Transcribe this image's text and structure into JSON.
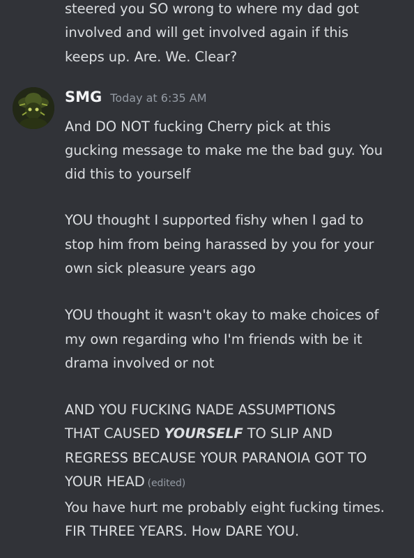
{
  "previous_message": {
    "lines": [
      "steered you SO wrong to where my dad got",
      "involved and will get involved again if this",
      "keeps up. Are. We. Clear?"
    ]
  },
  "message": {
    "username": "SMG",
    "timestamp": "Today at 6:35 AM",
    "avatar_icon": "avatar-image",
    "paragraph1": [
      "And DO NOT fucking Cherry pick at this",
      "gucking message to make me the bad guy. You",
      "did this to yourself"
    ],
    "paragraph2": [
      "YOU thought I supported fishy when I gad to",
      "stop him from being harassed by you for your",
      "own sick pleasure years ago"
    ],
    "paragraph3": [
      "YOU thought it wasn't okay to make choices of",
      "my own regarding who I'm friends with be it",
      "drama involved or not"
    ],
    "paragraph4": {
      "line1": "AND YOU FUCKING NADE ASSUMPTIONS",
      "line2_before": "THAT CAUSED ",
      "line2_emphasis": "YOURSELF",
      "line2_after": " TO SLIP AND",
      "line3": "REGRESS BECAUSE YOUR PARANOIA GOT TO",
      "line4": "YOUR HEAD",
      "edited_label": "(edited)"
    }
  },
  "follow_up_message": {
    "lines": [
      "You have hurt me probably eight fucking times.",
      "FIR THREE YEARS. How DARE YOU."
    ]
  }
}
